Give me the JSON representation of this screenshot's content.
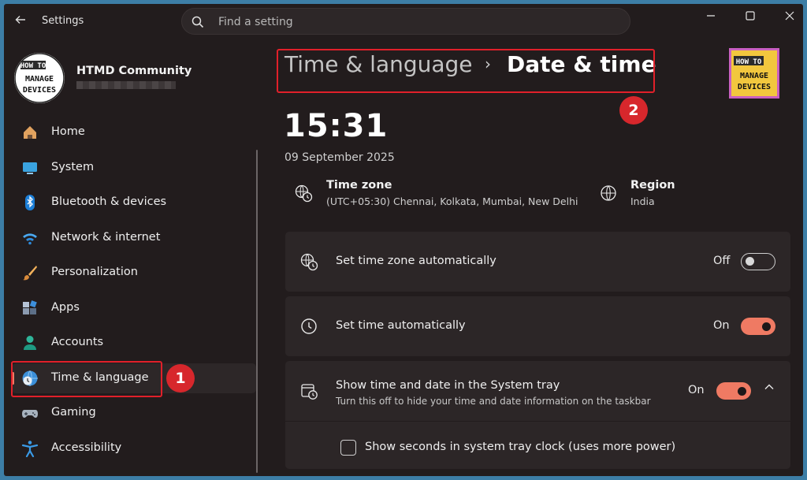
{
  "app": {
    "title": "Settings"
  },
  "search": {
    "placeholder": "Find a setting"
  },
  "profile": {
    "name": "HTMD Community",
    "avatar_text_top": "HOW TO",
    "avatar_text_mid": "MANAGE",
    "avatar_text_bot": "DEVICES"
  },
  "sidebar": {
    "items": [
      {
        "label": "Home",
        "icon": "home-icon"
      },
      {
        "label": "System",
        "icon": "system-icon"
      },
      {
        "label": "Bluetooth & devices",
        "icon": "bluetooth-icon"
      },
      {
        "label": "Network & internet",
        "icon": "wifi-icon"
      },
      {
        "label": "Personalization",
        "icon": "brush-icon"
      },
      {
        "label": "Apps",
        "icon": "apps-icon"
      },
      {
        "label": "Accounts",
        "icon": "accounts-icon"
      },
      {
        "label": "Time & language",
        "icon": "time-language-icon",
        "active": true
      },
      {
        "label": "Gaming",
        "icon": "gaming-icon"
      },
      {
        "label": "Accessibility",
        "icon": "accessibility-icon"
      }
    ]
  },
  "breadcrumb": {
    "parent": "Time & language",
    "separator": "›",
    "current": "Date & time"
  },
  "annotations": {
    "one": "1",
    "two": "2"
  },
  "clock": {
    "time": "15:31",
    "date": "09 September 2025"
  },
  "timezone": {
    "title": "Time zone",
    "value": "(UTC+05:30) Chennai, Kolkata, Mumbai, New Delhi"
  },
  "region": {
    "title": "Region",
    "value": "India"
  },
  "settings": {
    "auto_timezone": {
      "label": "Set time zone automatically",
      "state": "Off"
    },
    "auto_time": {
      "label": "Set time automatically",
      "state": "On"
    },
    "tray": {
      "label": "Show time and date in the System tray",
      "description": "Turn this off to hide your time and date information on the taskbar",
      "state": "On"
    },
    "seconds": {
      "label": "Show seconds in system tray clock (uses more power)",
      "checked": false
    }
  },
  "colors": {
    "accent": "#ef7a63",
    "annotation": "#e1202a",
    "background": "#221c1d",
    "card": "#2c2627"
  }
}
